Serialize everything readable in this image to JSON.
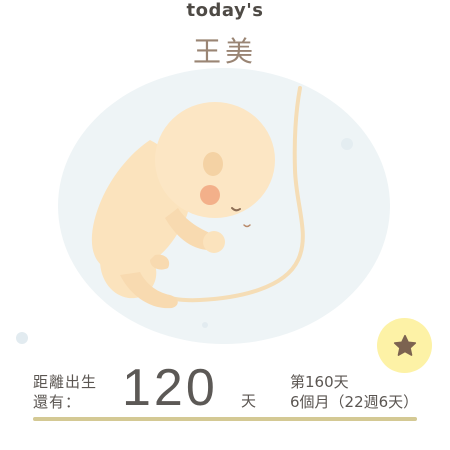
{
  "header": {
    "app_label": "today's",
    "baby_name": "王美"
  },
  "countdown": {
    "label_line1": "距離出生",
    "label_line2": "還有：",
    "days_remaining": "120",
    "unit": "天"
  },
  "pregnancy": {
    "day_text": "第160天",
    "month_week_text": "6個月（22週6天）"
  },
  "progress": {
    "fraction": 1.0
  },
  "actions": {
    "star_icon": "star-icon"
  },
  "colors": {
    "accent_yellow": "#fdf2a6",
    "star_brown": "#7c6350",
    "name_brown": "#9a8574",
    "progress_line": "#d4c994"
  }
}
